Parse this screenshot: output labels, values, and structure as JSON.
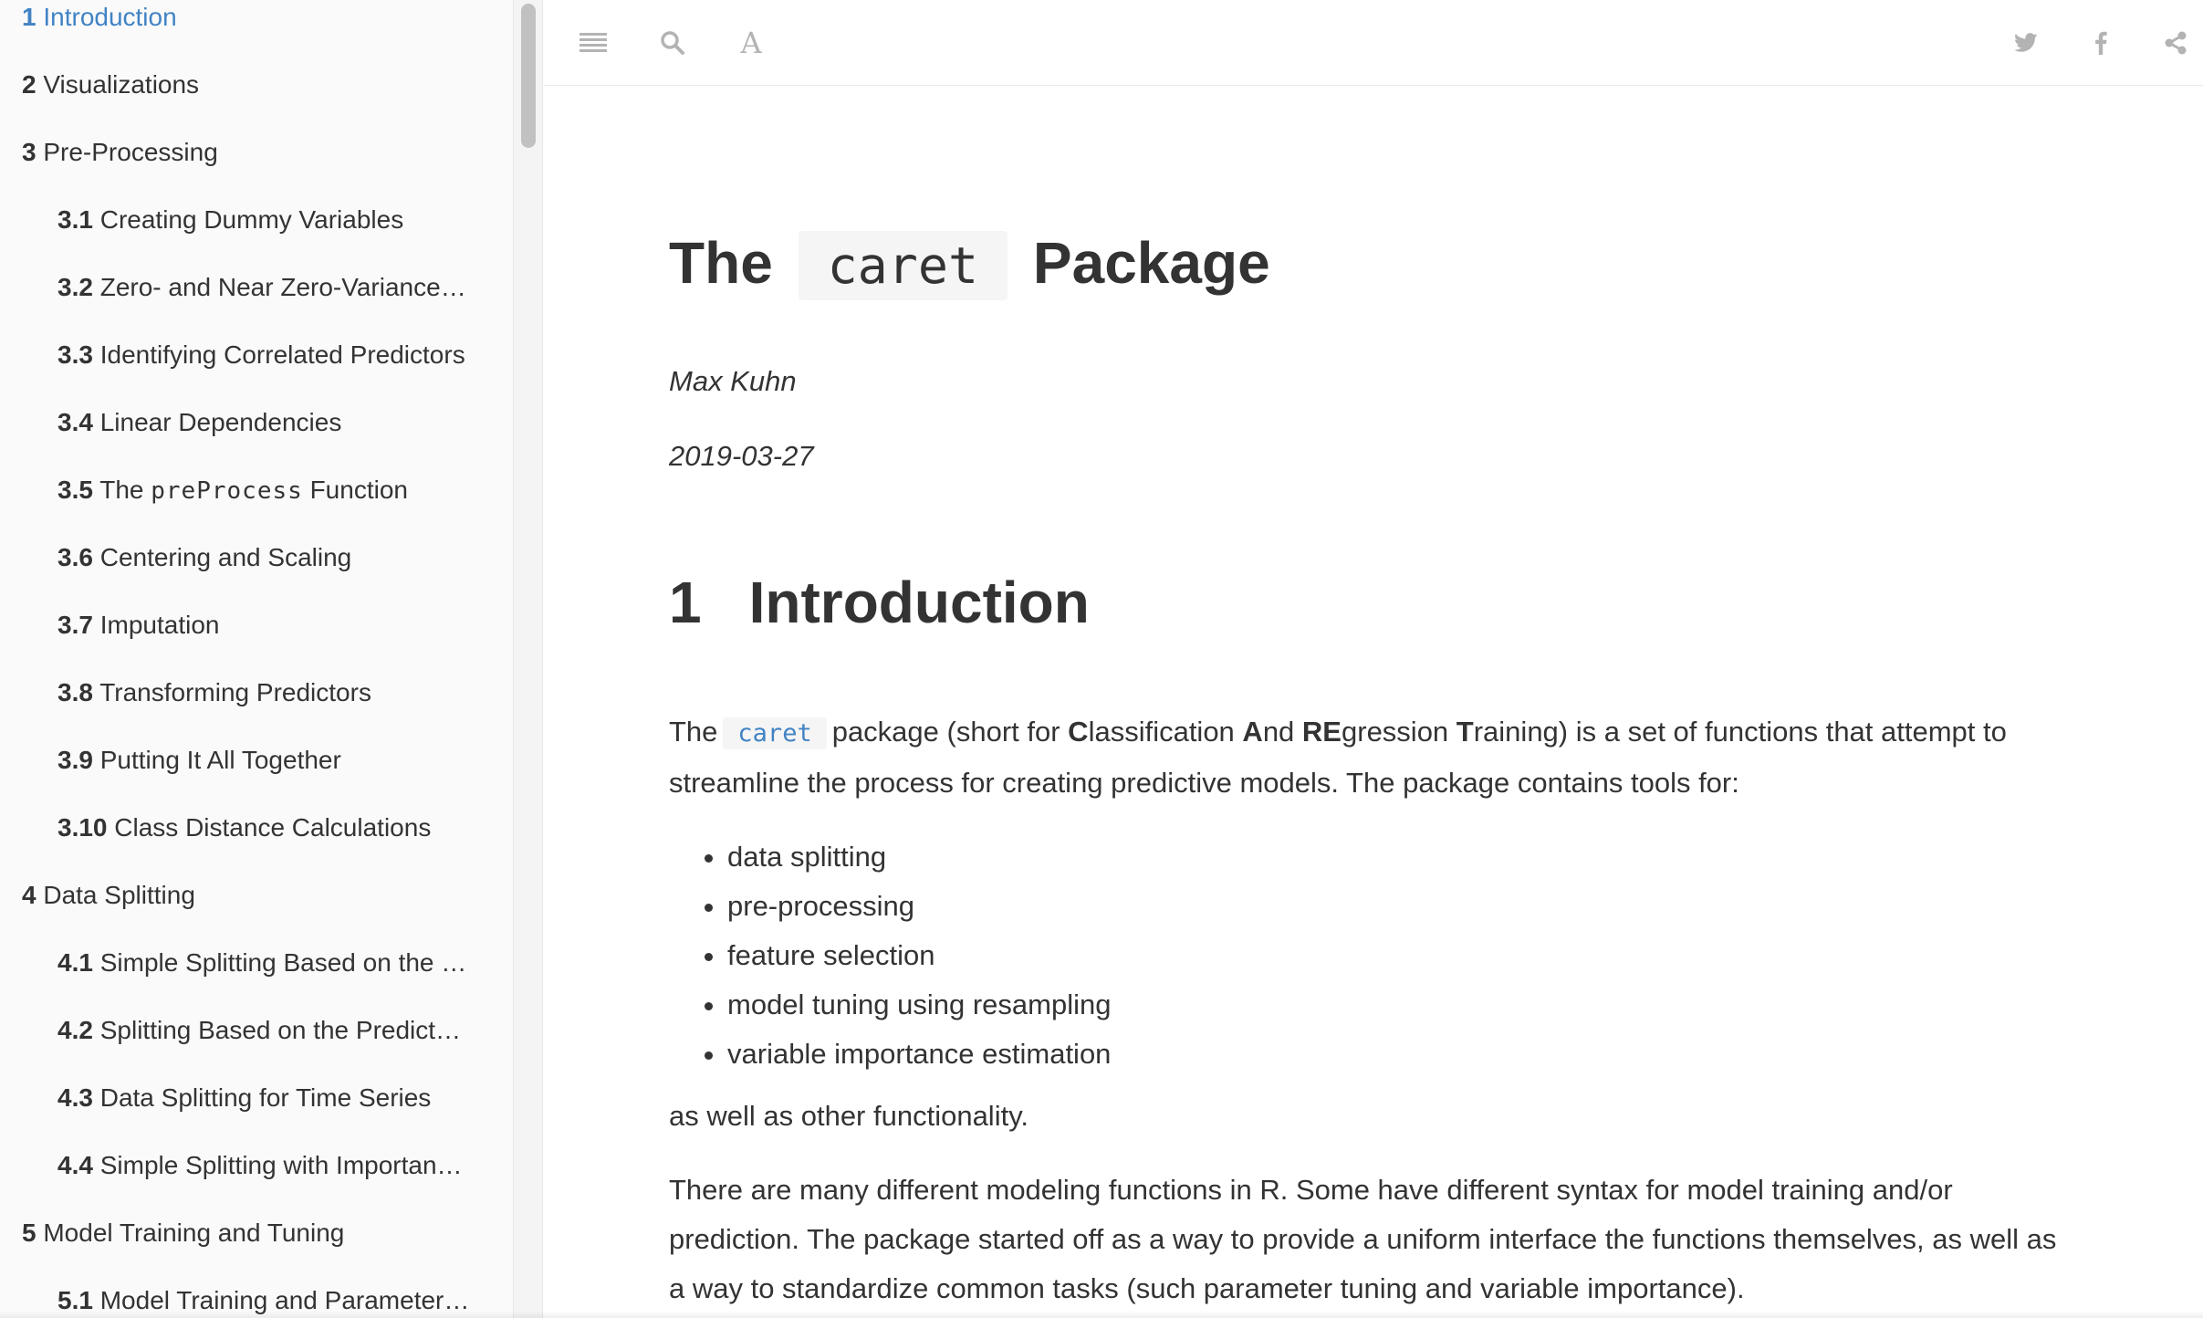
{
  "sidebar": {
    "items": [
      {
        "num": "1",
        "label": "Introduction",
        "level": 1,
        "active": true
      },
      {
        "num": "2",
        "label": "Visualizations",
        "level": 1
      },
      {
        "num": "3",
        "label": "Pre-Processing",
        "level": 1
      },
      {
        "num": "3.1",
        "label": "Creating Dummy Variables",
        "level": 2
      },
      {
        "num": "3.2",
        "label": "Zero- and Near Zero-Variance…",
        "level": 2
      },
      {
        "num": "3.3",
        "label": "Identifying Correlated Predictors",
        "level": 2
      },
      {
        "num": "3.4",
        "label": "Linear Dependencies",
        "level": 2
      },
      {
        "num": "3.5",
        "label_pre": "The ",
        "label_code": "preProcess",
        "label_post": " Function",
        "level": 2
      },
      {
        "num": "3.6",
        "label": "Centering and Scaling",
        "level": 2
      },
      {
        "num": "3.7",
        "label": "Imputation",
        "level": 2
      },
      {
        "num": "3.8",
        "label": "Transforming Predictors",
        "level": 2
      },
      {
        "num": "3.9",
        "label": "Putting It All Together",
        "level": 2
      },
      {
        "num": "3.10",
        "label": "Class Distance Calculations",
        "level": 2
      },
      {
        "num": "4",
        "label": "Data Splitting",
        "level": 1
      },
      {
        "num": "4.1",
        "label": "Simple Splitting Based on the …",
        "level": 2
      },
      {
        "num": "4.2",
        "label": "Splitting Based on the Predict…",
        "level": 2
      },
      {
        "num": "4.3",
        "label": "Data Splitting for Time Series",
        "level": 2
      },
      {
        "num": "4.4",
        "label": "Simple Splitting with Importan…",
        "level": 2
      },
      {
        "num": "5",
        "label": "Model Training and Tuning",
        "level": 1
      },
      {
        "num": "5.1",
        "label": "Model Training and Parameter…",
        "level": 2
      }
    ]
  },
  "toolbar": {
    "font_glyph": "A",
    "icons": [
      "menu-icon",
      "search-icon",
      "font-settings-icon",
      "twitter-icon",
      "facebook-icon",
      "share-icon"
    ]
  },
  "doc": {
    "title_pre": "The",
    "title_code": "caret",
    "title_post": "Package",
    "author": "Max Kuhn",
    "date": "2019-03-27",
    "section_num": "1",
    "section_title": "Introduction",
    "p1": {
      "t1": "The",
      "code": "caret",
      "t2": "package (short for ",
      "b1": "C",
      "t3": "lassification ",
      "b2": "A",
      "t4": "nd ",
      "b3": "RE",
      "t5": "gression ",
      "b4": "T",
      "t6": "raining) is a set of functions that attempt to streamline the process for creating predictive models. The package contains tools for:"
    },
    "bullets": [
      "data splitting",
      "pre-processing",
      "feature selection",
      "model tuning using resampling",
      "variable importance estimation"
    ],
    "p2": "as well as other functionality.",
    "p3": "There are many different modeling functions in R. Some have different syntax for model training and/or prediction. The package started off as a way to provide a uniform interface the functions themselves, as well as a way to standardize common tasks (such parameter tuning and variable importance)."
  },
  "colors": {
    "link": "#4183c4",
    "text": "#333333",
    "sidebar_bg": "#fafafa",
    "icon": "#b3b3b3"
  }
}
